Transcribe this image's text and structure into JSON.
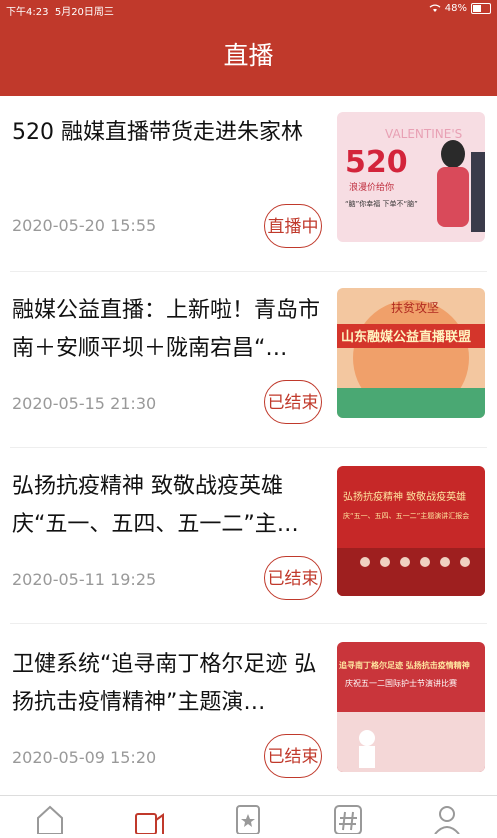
{
  "status": {
    "time": "下午4:23",
    "date": "5月20日周三",
    "battery": "48%"
  },
  "header": {
    "title": "直播"
  },
  "items": [
    {
      "title": "520 融媒直播带货走进朱家林",
      "date": "2020-05-20 15:55",
      "status": "直播中",
      "thumb": {
        "text_1": "VALENTINE'S",
        "text_2": "520",
        "text_3": "浪漫价给你",
        "text_4": "“脑”你幸福 下单不“脑”"
      }
    },
    {
      "title": "融媒公益直播：上新啦！青岛市南＋安顺平坝＋陇南宕昌“…",
      "date": "2020-05-15 21:30",
      "status": "已结束",
      "thumb": {
        "text_1": "扶贫攻坚",
        "text_2": "山东融媒公益直播联盟"
      }
    },
    {
      "title": "弘扬抗疫精神 致敬战疫英雄 庆“五一、五四、五一二”主…",
      "date": "2020-05-11 19:25",
      "status": "已结束",
      "thumb": {
        "text_1": "弘扬抗疫精神 致敬战疫英雄",
        "text_2": "庆“五一、五四、五一二”主题演讲汇报会"
      }
    },
    {
      "title": "卫健系统“追寻南丁格尔足迹 弘扬抗击疫情精神”主题演…",
      "date": "2020-05-09 15:20",
      "status": "已结束",
      "thumb": {
        "text_1": "追寻南丁格尔足迹 弘扬抗击疫情精神",
        "text_2": "庆祝五一二国际护士节演讲比赛"
      }
    }
  ],
  "tabbar": {
    "icons": [
      "home-icon",
      "video-icon",
      "star-card-icon",
      "hash-icon",
      "user-icon"
    ]
  }
}
